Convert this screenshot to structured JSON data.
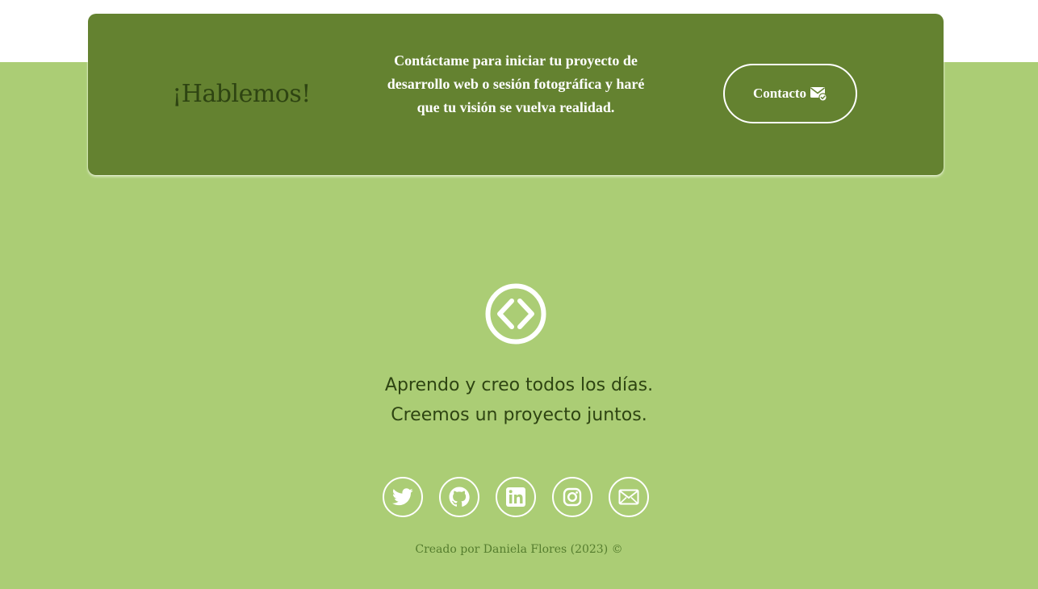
{
  "cta": {
    "heading": "¡Hablemos!",
    "text": "Contáctame para iniciar tu proyecto de desarrollo web o sesión fotográfica y haré que tu visión se vuelva realidad.",
    "button_label": "Contacto",
    "button_icon": "envelope-check-icon"
  },
  "footer": {
    "logo_icon": "code-icon",
    "tagline_line1": "Aprendo y creo todos los días.",
    "tagline_line2": "Creemos un proyecto juntos.",
    "social": [
      {
        "name": "twitter-icon"
      },
      {
        "name": "github-icon"
      },
      {
        "name": "linkedin-icon"
      },
      {
        "name": "instagram-icon"
      },
      {
        "name": "envelope-icon"
      }
    ],
    "credit": "Creado por Daniela Flores (2023) ©"
  },
  "colors": {
    "page_background": "#ffffff",
    "footer_background": "#abcd75",
    "card_background": "#648230",
    "heading_text": "#2e4412",
    "white": "#ffffff",
    "credit_text": "#557d2e"
  }
}
